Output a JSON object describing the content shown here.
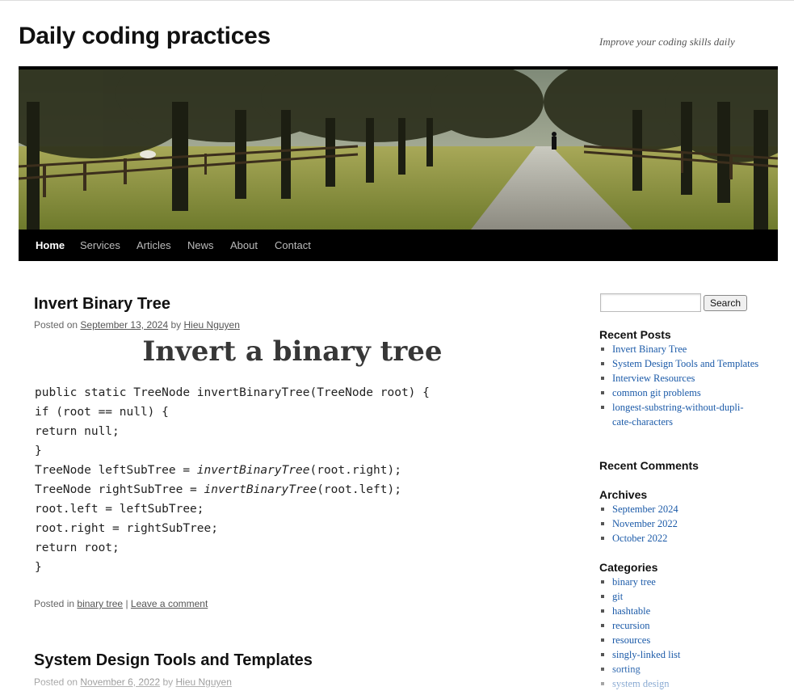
{
  "site": {
    "title": "Daily coding practices",
    "description": "Improve your coding skills daily"
  },
  "nav": {
    "items": [
      {
        "label": "Home",
        "current": true
      },
      {
        "label": "Services"
      },
      {
        "label": "Articles"
      },
      {
        "label": "News"
      },
      {
        "label": "About"
      },
      {
        "label": "Contact"
      }
    ]
  },
  "posts": [
    {
      "title": "Invert Binary Tree",
      "posted_on_prefix": "Posted on",
      "date": "September 13, 2024",
      "by": "by",
      "author": "Hieu Nguyen",
      "heading": "Invert a binary tree",
      "code": {
        "line1": "public static TreeNode invertBinaryTree(TreeNode root) {",
        "line2": "if (root == null) {",
        "line3": "return null;",
        "line4": "}",
        "line5_a": "TreeNode leftSubTree = ",
        "line5_b": "invertBinaryTree",
        "line5_c": "(root.right);",
        "line6_a": "TreeNode rightSubTree = ",
        "line6_b": "invertBinaryTree",
        "line6_c": "(root.left);",
        "line7": "root.left = leftSubTree;",
        "line8": "root.right = rightSubTree;",
        "line9": "return root;",
        "line10": "}"
      },
      "posted_in_prefix": "Posted in",
      "category": "binary tree",
      "separator": "|",
      "comment_link": "Leave a comment"
    },
    {
      "title": "System Design Tools and Templates",
      "posted_on_prefix": "Posted on",
      "date": "November 6, 2022",
      "by": "by",
      "author": "Hieu Nguyen"
    }
  ],
  "sidebar": {
    "search_button": "Search",
    "search_value": "",
    "recent_posts_title": "Recent Posts",
    "recent_posts": [
      "Invert Binary Tree",
      "System Design Tools and Templates",
      "Interview Resources",
      "common git problems",
      "longest-substring-without-dupli-cate-characters"
    ],
    "recent_comments_title": "Recent Comments",
    "archives_title": "Archives",
    "archives": [
      "September 2024",
      "November 2022",
      "October 2022"
    ],
    "categories_title": "Categories",
    "categories": [
      "binary tree",
      "git",
      "hashtable",
      "recursion",
      "resources",
      "singly-linked list",
      "sorting",
      "system design"
    ]
  }
}
